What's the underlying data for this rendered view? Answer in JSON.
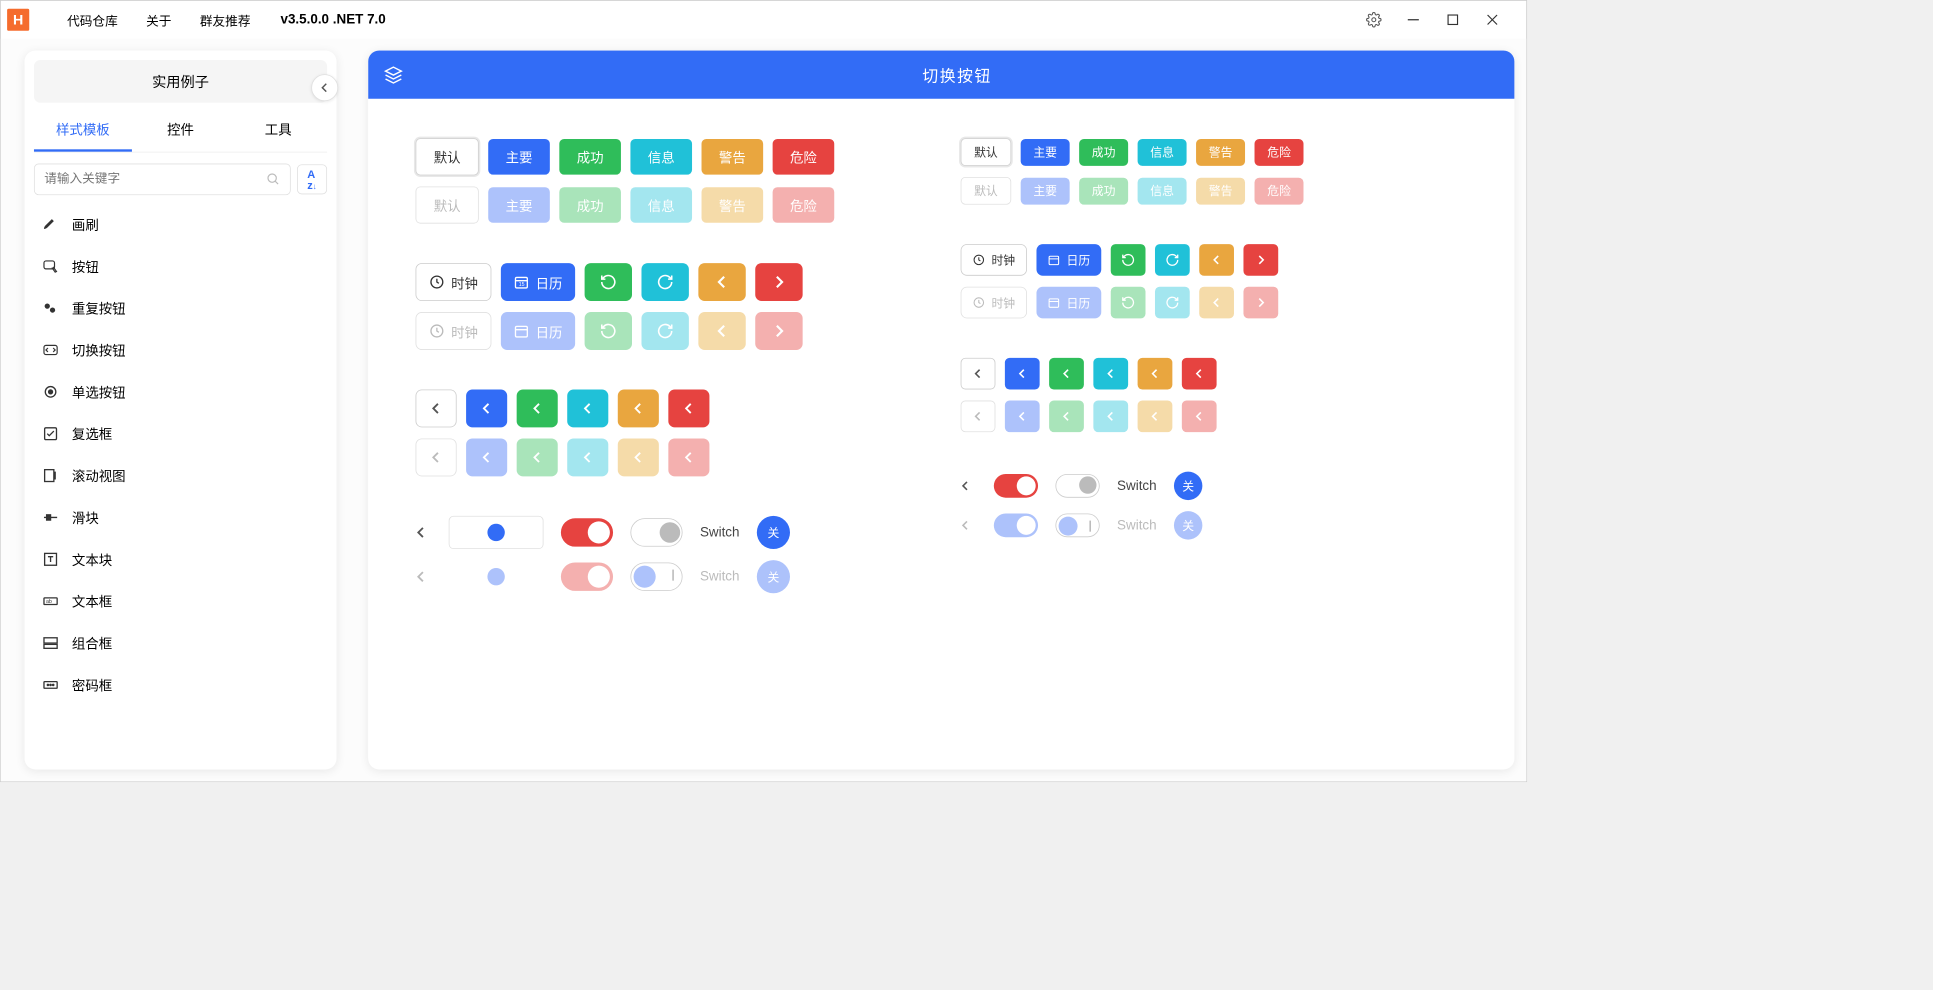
{
  "titlebar": {
    "logo_letter": "H",
    "menu": {
      "repo": "代码仓库",
      "about": "关于",
      "recommend": "群友推荐"
    },
    "version": "v3.5.0.0 .NET 7.0"
  },
  "sidebar": {
    "header": "实用例子",
    "tabs": {
      "templates": "样式模板",
      "controls": "控件",
      "tools": "工具"
    },
    "search_placeholder": "请输入关键字",
    "sort_label": "A↓Z",
    "items": [
      {
        "label": "画刷"
      },
      {
        "label": "按钮"
      },
      {
        "label": "重复按钮"
      },
      {
        "label": "切换按钮"
      },
      {
        "label": "单选按钮"
      },
      {
        "label": "复选框"
      },
      {
        "label": "滚动视图"
      },
      {
        "label": "滑块"
      },
      {
        "label": "文本块"
      },
      {
        "label": "文本框"
      },
      {
        "label": "组合框"
      },
      {
        "label": "密码框"
      }
    ]
  },
  "main": {
    "title": "切换按钮",
    "labels": {
      "default": "默认",
      "primary": "主要",
      "success": "成功",
      "info": "信息",
      "warning": "警告",
      "danger": "危险",
      "clock": "时钟",
      "calendar": "日历",
      "switch": "Switch",
      "off": "关"
    }
  }
}
